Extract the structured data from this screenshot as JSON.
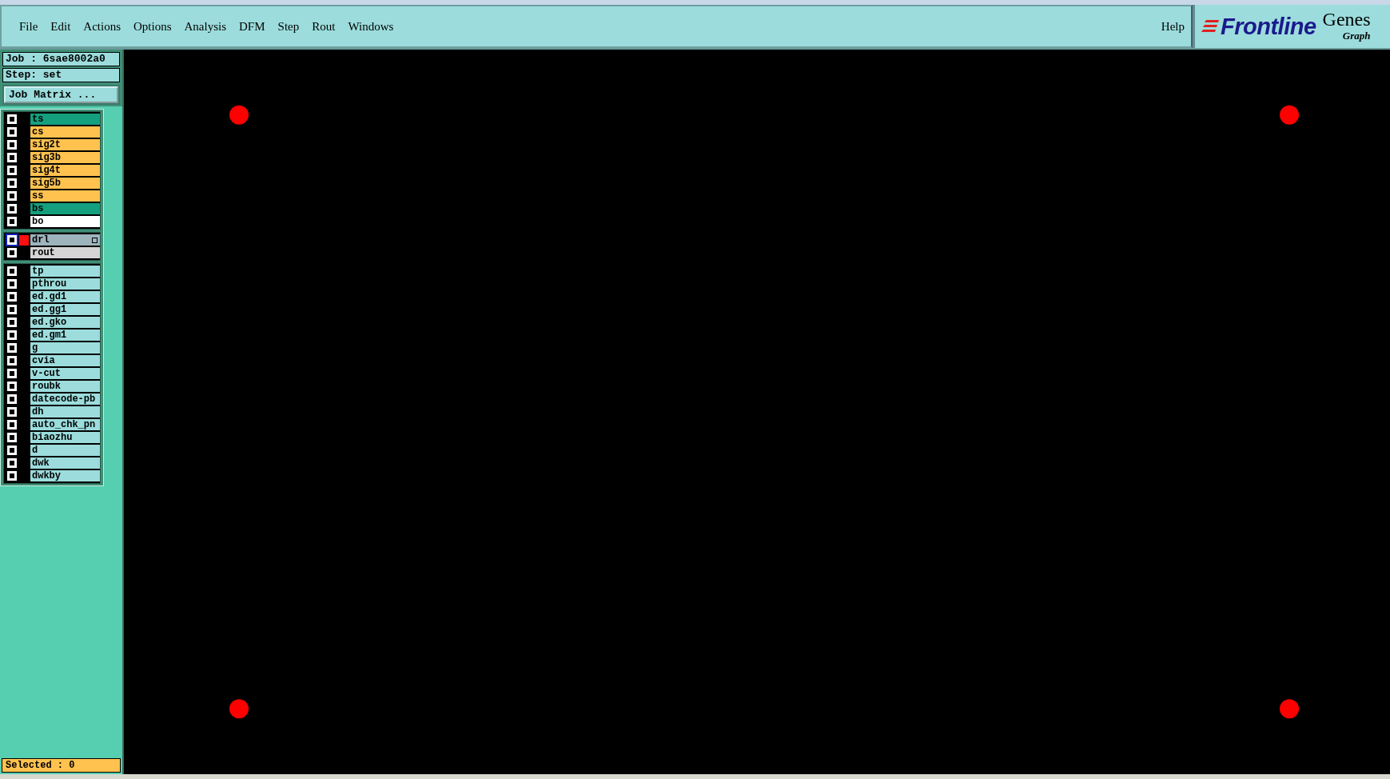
{
  "menu": [
    "File",
    "Edit",
    "Actions",
    "Options",
    "Analysis",
    "DFM",
    "Step",
    "Rout",
    "Windows"
  ],
  "help": "Help",
  "logo": {
    "brand": "Frontline",
    "product": "Genes",
    "subtitle": "Graph"
  },
  "job": {
    "job_label": "Job : 6sae8002a0",
    "step_label": "Step: set",
    "matrix_button": "Job Matrix ..."
  },
  "layer_groups": [
    {
      "layers": [
        {
          "name": "ts",
          "color": "#14a07e",
          "checked": false,
          "work": false
        },
        {
          "name": "cs",
          "color": "#ffc24f",
          "checked": false,
          "work": false
        },
        {
          "name": "sig2t",
          "color": "#ffc24f",
          "checked": false,
          "work": false
        },
        {
          "name": "sig3b",
          "color": "#ffc24f",
          "checked": false,
          "work": false
        },
        {
          "name": "sig4t",
          "color": "#ffc24f",
          "checked": false,
          "work": false
        },
        {
          "name": "sig5b",
          "color": "#ffc24f",
          "checked": false,
          "work": false
        },
        {
          "name": "ss",
          "color": "#ffc24f",
          "checked": false,
          "work": false
        },
        {
          "name": "bs",
          "color": "#14a07e",
          "checked": false,
          "work": false
        },
        {
          "name": "bo",
          "color": "#ffffff",
          "checked": false,
          "work": false
        }
      ]
    },
    {
      "layers": [
        {
          "name": "drl",
          "color": "#9db4bd",
          "checked": false,
          "work": true
        },
        {
          "name": "rout",
          "color": "#d4d4d4",
          "checked": false,
          "work": false
        }
      ]
    },
    {
      "layers": [
        {
          "name": "tp",
          "color": "#9cdcdc",
          "checked": false,
          "work": false
        },
        {
          "name": "pthrou",
          "color": "#9cdcdc",
          "checked": false,
          "work": false
        },
        {
          "name": "ed.gd1",
          "color": "#9cdcdc",
          "checked": false,
          "work": false
        },
        {
          "name": "ed.gg1",
          "color": "#9cdcdc",
          "checked": false,
          "work": false
        },
        {
          "name": "ed.gko",
          "color": "#9cdcdc",
          "checked": false,
          "work": false
        },
        {
          "name": "ed.gm1",
          "color": "#9cdcdc",
          "checked": false,
          "work": false
        },
        {
          "name": "g",
          "color": "#9cdcdc",
          "checked": false,
          "work": false
        },
        {
          "name": "cvia",
          "color": "#9cdcdc",
          "checked": false,
          "work": false
        },
        {
          "name": "v-cut",
          "color": "#9cdcdc",
          "checked": false,
          "work": false
        },
        {
          "name": "roubk",
          "color": "#9cdcdc",
          "checked": false,
          "work": false
        },
        {
          "name": "datecode-pb",
          "color": "#9cdcdc",
          "checked": false,
          "work": false
        },
        {
          "name": "dh",
          "color": "#9cdcdc",
          "checked": false,
          "work": false
        },
        {
          "name": "auto_chk_pn",
          "color": "#9cdcdc",
          "checked": false,
          "work": false
        },
        {
          "name": "biaozhu",
          "color": "#9cdcdc",
          "checked": false,
          "work": false
        },
        {
          "name": "d",
          "color": "#9cdcdc",
          "checked": false,
          "work": false
        },
        {
          "name": "dwk",
          "color": "#9cdcdc",
          "checked": false,
          "work": false
        },
        {
          "name": "dwkby",
          "color": "#9cdcdc",
          "checked": false,
          "work": false
        }
      ]
    }
  ],
  "status": "Selected : 0"
}
